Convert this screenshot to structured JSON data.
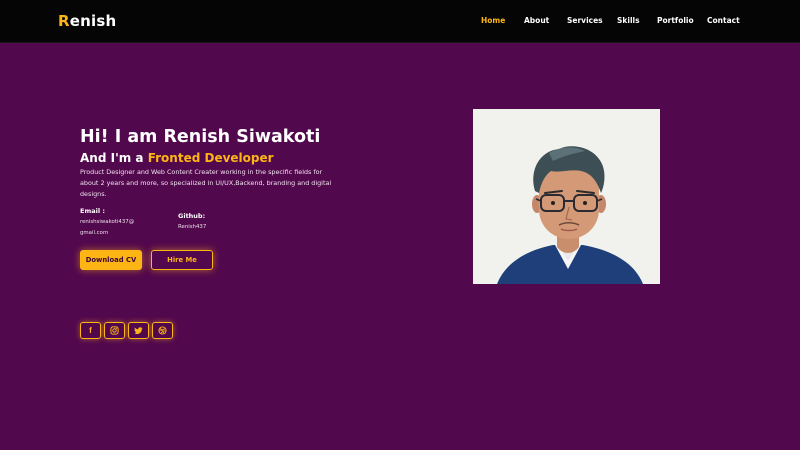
{
  "brand": {
    "first_letter": "R",
    "rest": "enish"
  },
  "nav": {
    "items": [
      {
        "label": "Home",
        "active": true
      },
      {
        "label": "About",
        "active": false
      },
      {
        "label": "Services",
        "active": false
      },
      {
        "label": "Skills",
        "active": false
      },
      {
        "label": "Portfolio",
        "active": false
      },
      {
        "label": "Contact",
        "active": false
      }
    ]
  },
  "hero": {
    "title": "Hi! I am Renish Siwakoti",
    "subtitle_prefix": "And I'm a ",
    "subtitle_highlight": "Fronted Developer",
    "description": "Product Designer and Web Content Creater working in the specific fields for about 2 years and more, so specialized in UI/UX,Backend, branding and digital designs."
  },
  "contact": {
    "email_label": "Email :",
    "email_value_line1": "renishsiwakoti437@",
    "email_value_line2": "gmail.com",
    "github_label": "Github:",
    "github_value": "Renish437"
  },
  "buttons": {
    "download_cv": "Download CV",
    "hire_me": "Hire Me"
  },
  "social": [
    {
      "name": "facebook-icon",
      "glyph": "f"
    },
    {
      "name": "instagram-icon"
    },
    {
      "name": "twitter-icon"
    },
    {
      "name": "dribbble-icon"
    }
  ],
  "profile_photo": {
    "name": "profile-photo"
  },
  "colors": {
    "background": "#52084d",
    "navbar": "#050505",
    "accent": "#fdb515",
    "text": "#ffffff"
  }
}
